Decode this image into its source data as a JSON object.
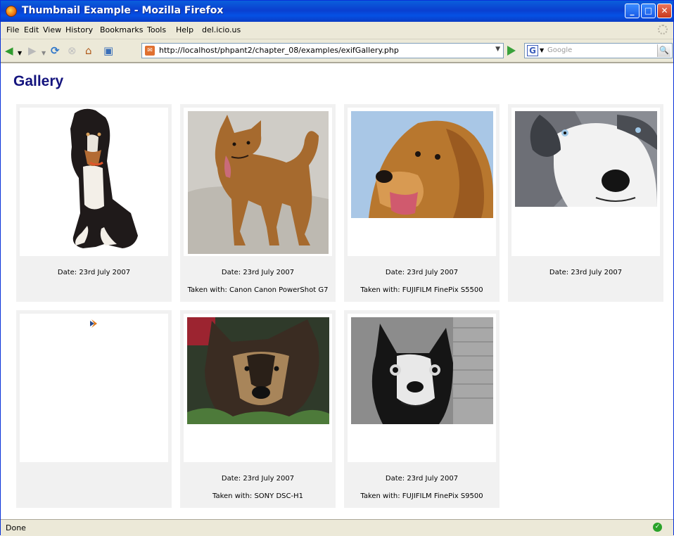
{
  "window": {
    "title": "Thumbnail Example - Mozilla Firefox"
  },
  "menu": [
    "File",
    "Edit",
    "View",
    "History",
    "Bookmarks",
    "Tools",
    "Help",
    "del.icio.us"
  ],
  "address": {
    "url": "http://localhost/phpant2/chapter_08/examples/exifGallery.php"
  },
  "search": {
    "placeholder": "Google"
  },
  "page": {
    "heading": "Gallery"
  },
  "gallery": [
    {
      "date": "Date: 23rd July 2007",
      "camera": "",
      "image": "dog-sitting-photo"
    },
    {
      "date": "Date: 23rd July 2007",
      "camera": "Taken with: Canon Canon PowerShot G7",
      "image": "dog-standing-photo"
    },
    {
      "date": "Date: 23rd July 2007",
      "camera": "Taken with: FUJIFILM FinePix S5500",
      "image": "golden-retriever-photo"
    },
    {
      "date": "Date: 23rd July 2007",
      "camera": "",
      "image": "husky-closeup-photo"
    },
    {
      "date": "",
      "camera": "",
      "image": "missing-image-icon"
    },
    {
      "date": "Date: 23rd July 2007",
      "camera": "Taken with: SONY DSC-H1",
      "image": "shepherd-dog-photo"
    },
    {
      "date": "Date: 23rd July 2007",
      "camera": "Taken with: FUJIFILM FinePix S9500",
      "image": "boston-terrier-photo"
    }
  ],
  "status": {
    "text": "Done"
  },
  "colors": {
    "heading": "#14147e",
    "titlebar": "#0a3fcf",
    "card": "#f1f1f1"
  }
}
